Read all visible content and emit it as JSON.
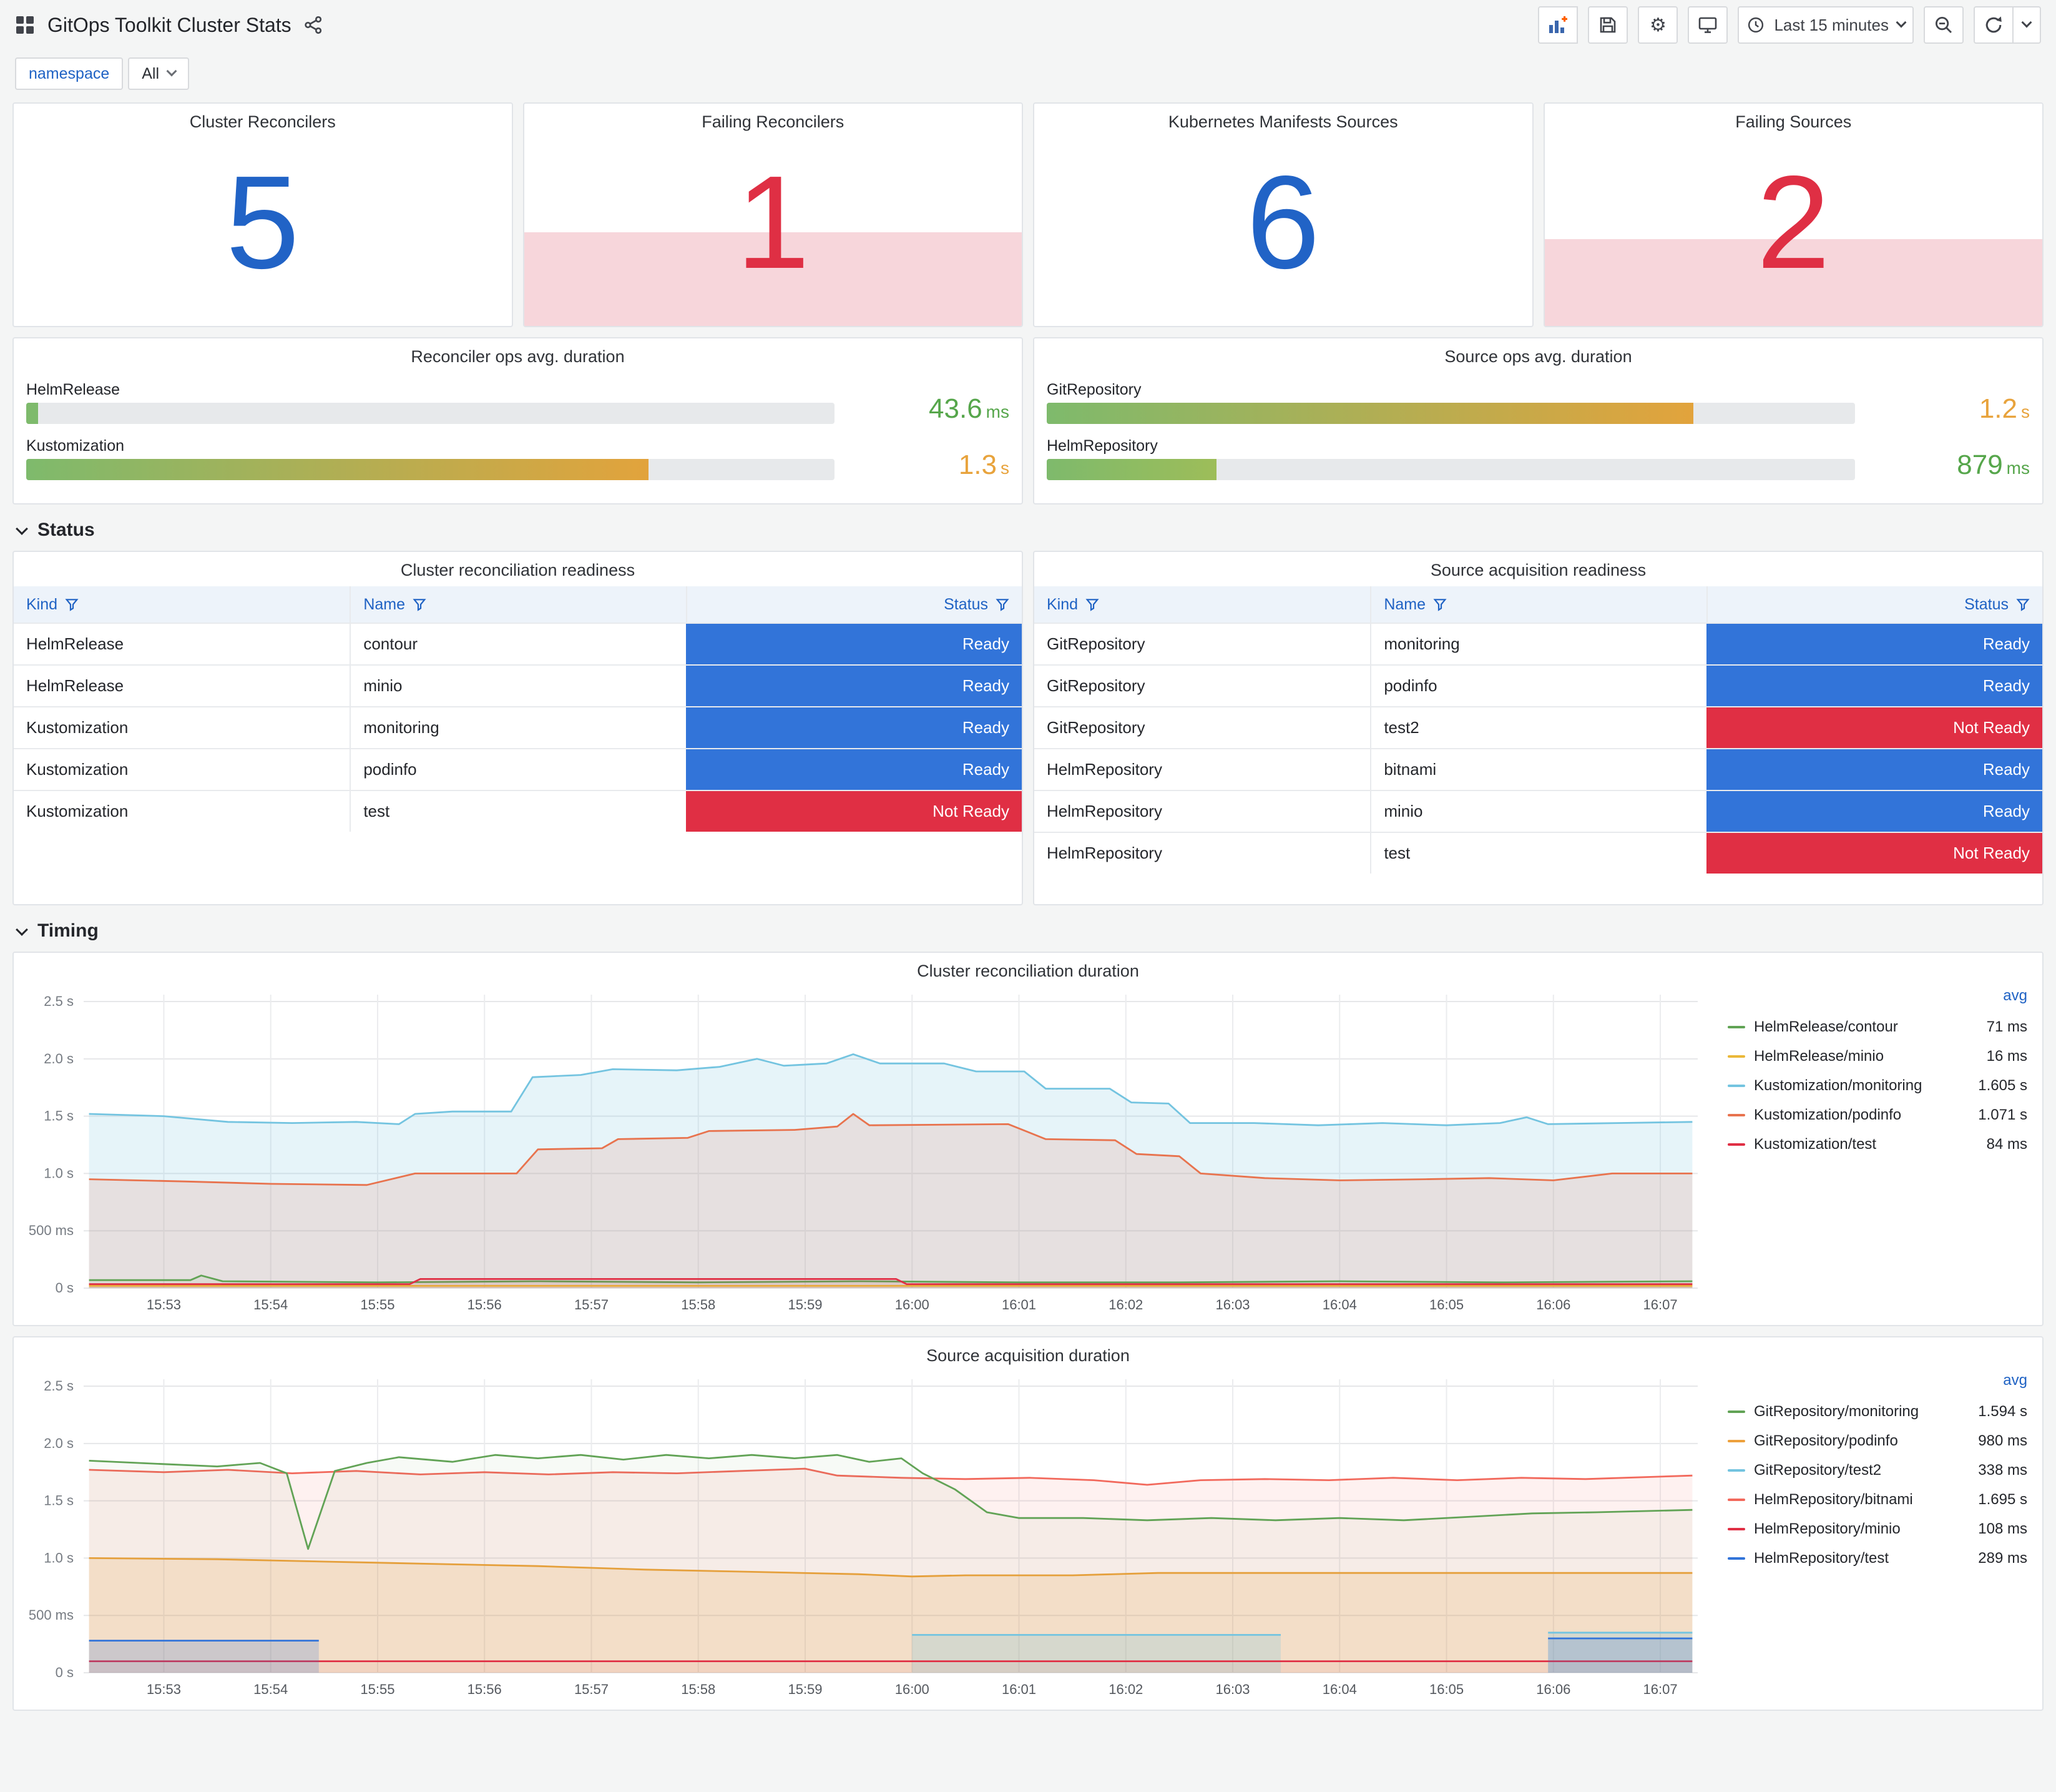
{
  "header": {
    "title": "GitOps Toolkit Cluster Stats",
    "time_picker": {
      "label": "Last 15 minutes"
    },
    "icons": [
      "dashboard-grid",
      "share-alt",
      "add-panel",
      "save",
      "settings-gear",
      "tv-mode",
      "clock",
      "zoom-out",
      "refresh",
      "caret-down"
    ]
  },
  "variables": {
    "label": "namespace",
    "value": "All"
  },
  "colors": {
    "accent_blue": "#2163c6",
    "alert_red": "#df2f44",
    "ready_bg": "#3274d9",
    "not_ready_bg": "#e02f44",
    "threshold_fill": "#f7d6db",
    "link_blue": "#1f62c4",
    "green_text": "#56a64b",
    "orange_text": "#e8a33c"
  },
  "stats": [
    {
      "title": "Cluster Reconcilers",
      "value": "5",
      "color": "#2163c6",
      "fill_pct": 0
    },
    {
      "title": "Failing Reconcilers",
      "value": "1",
      "color": "#df2f44",
      "fill_pct": 42
    },
    {
      "title": "Kubernetes Manifests Sources",
      "value": "6",
      "color": "#2163c6",
      "fill_pct": 0
    },
    {
      "title": "Failing Sources",
      "value": "2",
      "color": "#df2f44",
      "fill_pct": 39
    }
  ],
  "gauges": [
    {
      "title": "Reconciler ops avg. duration",
      "bars": [
        {
          "label": "HelmRelease",
          "value": "43.6",
          "unit": "ms",
          "pct": 1.5,
          "bar_from": "#7eba6c",
          "bar_to": "#7eba6c",
          "value_color": "#56a64b"
        },
        {
          "label": "Kustomization",
          "value": "1.3",
          "unit": "s",
          "pct": 77,
          "bar_from": "#7eba6c",
          "bar_to": "#e2a33c",
          "value_color": "#e8a33c"
        }
      ]
    },
    {
      "title": "Source ops avg. duration",
      "bars": [
        {
          "label": "GitRepository",
          "value": "1.2",
          "unit": "s",
          "pct": 80,
          "bar_from": "#7eba6c",
          "bar_to": "#e2a33c",
          "value_color": "#e8a33c"
        },
        {
          "label": "HelmRepository",
          "value": "879",
          "unit": "ms",
          "pct": 21,
          "bar_from": "#7eba6c",
          "bar_to": "#9dbd59",
          "value_color": "#56a64b"
        }
      ]
    }
  ],
  "sections": {
    "status": "Status",
    "timing": "Timing"
  },
  "tables": [
    {
      "title": "Cluster reconciliation readiness",
      "columns": [
        "Kind",
        "Name",
        "Status"
      ],
      "rows": [
        [
          "HelmRelease",
          "contour",
          "Ready"
        ],
        [
          "HelmRelease",
          "minio",
          "Ready"
        ],
        [
          "Kustomization",
          "monitoring",
          "Ready"
        ],
        [
          "Kustomization",
          "podinfo",
          "Ready"
        ],
        [
          "Kustomization",
          "test",
          "Not Ready"
        ]
      ]
    },
    {
      "title": "Source acquisition readiness",
      "columns": [
        "Kind",
        "Name",
        "Status"
      ],
      "rows": [
        [
          "GitRepository",
          "monitoring",
          "Ready"
        ],
        [
          "GitRepository",
          "podinfo",
          "Ready"
        ],
        [
          "GitRepository",
          "test2",
          "Not Ready"
        ],
        [
          "HelmRepository",
          "bitnami",
          "Ready"
        ],
        [
          "HelmRepository",
          "minio",
          "Ready"
        ],
        [
          "HelmRepository",
          "test",
          "Not Ready"
        ]
      ]
    }
  ],
  "chart_data": [
    {
      "type": "line",
      "title": "Cluster reconciliation duration",
      "legend_header": "avg",
      "xlim": [
        -0.75,
        14.35
      ],
      "ylim": [
        0,
        2.56
      ],
      "x_ticks": [
        "15:53",
        "15:54",
        "15:55",
        "15:56",
        "15:57",
        "15:58",
        "15:59",
        "16:00",
        "16:01",
        "16:02",
        "16:03",
        "16:04",
        "16:05",
        "16:06",
        "16:07"
      ],
      "y_ticks": [
        [
          0,
          "0 s"
        ],
        [
          0.5,
          "500 ms"
        ],
        [
          1,
          "1.0 s"
        ],
        [
          1.5,
          "1.5 s"
        ],
        [
          2,
          "2.0 s"
        ],
        [
          2.5,
          "2.5 s"
        ]
      ],
      "series": [
        {
          "name": "HelmRelease/contour",
          "avg": "71 ms",
          "color": "#61a355",
          "fill": 0.08,
          "z": 2,
          "points": [
            [
              -0.7,
              0.07
            ],
            [
              0.25,
              0.07
            ],
            [
              0.35,
              0.11
            ],
            [
              0.55,
              0.06
            ],
            [
              2,
              0.05
            ],
            [
              3.5,
              0.06
            ],
            [
              5,
              0.05
            ],
            [
              6.5,
              0.06
            ],
            [
              8,
              0.05
            ],
            [
              9.5,
              0.05
            ],
            [
              11,
              0.06
            ],
            [
              12.5,
              0.05
            ],
            [
              14.3,
              0.06
            ]
          ]
        },
        {
          "name": "HelmRelease/minio",
          "avg": "16 ms",
          "color": "#eab839",
          "fill": 0.08,
          "z": 3,
          "points": [
            [
              -0.7,
              0.02
            ],
            [
              14.3,
              0.02
            ]
          ]
        },
        {
          "name": "Kustomization/monitoring",
          "avg": "1.605 s",
          "color": "#74c4e0",
          "fill": 0.18,
          "z": 0,
          "points": [
            [
              -0.7,
              1.52
            ],
            [
              0,
              1.5
            ],
            [
              0.6,
              1.45
            ],
            [
              1.2,
              1.44
            ],
            [
              1.8,
              1.45
            ],
            [
              2.2,
              1.43
            ],
            [
              2.35,
              1.52
            ],
            [
              2.7,
              1.54
            ],
            [
              3.25,
              1.54
            ],
            [
              3.45,
              1.84
            ],
            [
              3.9,
              1.86
            ],
            [
              4.2,
              1.91
            ],
            [
              4.8,
              1.9
            ],
            [
              5.2,
              1.93
            ],
            [
              5.55,
              2.0
            ],
            [
              5.8,
              1.94
            ],
            [
              6.2,
              1.96
            ],
            [
              6.45,
              2.04
            ],
            [
              6.7,
              1.96
            ],
            [
              7.3,
              1.96
            ],
            [
              7.6,
              1.89
            ],
            [
              8.05,
              1.89
            ],
            [
              8.25,
              1.74
            ],
            [
              8.85,
              1.74
            ],
            [
              9.05,
              1.62
            ],
            [
              9.4,
              1.61
            ],
            [
              9.6,
              1.44
            ],
            [
              10.2,
              1.44
            ],
            [
              10.8,
              1.42
            ],
            [
              11.4,
              1.44
            ],
            [
              12,
              1.42
            ],
            [
              12.5,
              1.44
            ],
            [
              12.75,
              1.49
            ],
            [
              12.95,
              1.43
            ],
            [
              13.6,
              1.44
            ],
            [
              14.3,
              1.45
            ]
          ]
        },
        {
          "name": "Kustomization/podinfo",
          "avg": "1.071 s",
          "color": "#e8734e",
          "fill": 0.15,
          "z": 1,
          "points": [
            [
              -0.7,
              0.95
            ],
            [
              0.2,
              0.93
            ],
            [
              1,
              0.91
            ],
            [
              1.9,
              0.9
            ],
            [
              2.35,
              1.0
            ],
            [
              3.3,
              1.0
            ],
            [
              3.5,
              1.21
            ],
            [
              4.1,
              1.22
            ],
            [
              4.25,
              1.3
            ],
            [
              4.9,
              1.31
            ],
            [
              5.1,
              1.37
            ],
            [
              5.9,
              1.38
            ],
            [
              6.3,
              1.41
            ],
            [
              6.45,
              1.52
            ],
            [
              6.6,
              1.42
            ],
            [
              7.9,
              1.43
            ],
            [
              8.25,
              1.3
            ],
            [
              8.9,
              1.29
            ],
            [
              9.1,
              1.17
            ],
            [
              9.5,
              1.15
            ],
            [
              9.7,
              1.0
            ],
            [
              10.3,
              0.96
            ],
            [
              11,
              0.94
            ],
            [
              11.8,
              0.95
            ],
            [
              12.4,
              0.96
            ],
            [
              13,
              0.94
            ],
            [
              13.55,
              1.0
            ],
            [
              14.3,
              1.0
            ]
          ]
        },
        {
          "name": "Kustomization/test",
          "avg": "84 ms",
          "color": "#e02f44",
          "fill": 0.1,
          "z": 4,
          "points": [
            [
              -0.7,
              0.035
            ],
            [
              2.3,
              0.035
            ],
            [
              2.4,
              0.08
            ],
            [
              6.85,
              0.08
            ],
            [
              6.95,
              0.035
            ],
            [
              14.3,
              0.035
            ]
          ]
        }
      ]
    },
    {
      "type": "line",
      "title": "Source acquisition duration",
      "legend_header": "avg",
      "xlim": [
        -0.75,
        14.35
      ],
      "ylim": [
        0,
        2.56
      ],
      "x_ticks": [
        "15:53",
        "15:54",
        "15:55",
        "15:56",
        "15:57",
        "15:58",
        "15:59",
        "16:00",
        "16:01",
        "16:02",
        "16:03",
        "16:04",
        "16:05",
        "16:06",
        "16:07"
      ],
      "y_ticks": [
        [
          0,
          "0 s"
        ],
        [
          0.5,
          "500 ms"
        ],
        [
          1,
          "1.0 s"
        ],
        [
          1.5,
          "1.5 s"
        ],
        [
          2,
          "2.0 s"
        ],
        [
          2.5,
          "2.5 s"
        ]
      ],
      "series": [
        {
          "name": "GitRepository/monitoring",
          "avg": "1.594 s",
          "color": "#62a356",
          "fill": 0.05,
          "z": 2,
          "points": [
            [
              -0.7,
              1.85
            ],
            [
              0,
              1.82
            ],
            [
              0.5,
              1.8
            ],
            [
              0.9,
              1.83
            ],
            [
              1.15,
              1.74
            ],
            [
              1.35,
              1.08
            ],
            [
              1.6,
              1.76
            ],
            [
              1.9,
              1.83
            ],
            [
              2.2,
              1.88
            ],
            [
              2.7,
              1.84
            ],
            [
              3.1,
              1.9
            ],
            [
              3.5,
              1.87
            ],
            [
              3.9,
              1.9
            ],
            [
              4.3,
              1.86
            ],
            [
              4.7,
              1.9
            ],
            [
              5.1,
              1.87
            ],
            [
              5.5,
              1.9
            ],
            [
              5.9,
              1.87
            ],
            [
              6.3,
              1.9
            ],
            [
              6.6,
              1.84
            ],
            [
              6.9,
              1.87
            ],
            [
              7.1,
              1.74
            ],
            [
              7.4,
              1.6
            ],
            [
              7.7,
              1.4
            ],
            [
              8,
              1.35
            ],
            [
              8.6,
              1.35
            ],
            [
              9.2,
              1.33
            ],
            [
              9.8,
              1.35
            ],
            [
              10.4,
              1.33
            ],
            [
              11,
              1.35
            ],
            [
              11.6,
              1.33
            ],
            [
              12.2,
              1.36
            ],
            [
              12.8,
              1.39
            ],
            [
              13.4,
              1.4
            ],
            [
              14.3,
              1.42
            ]
          ]
        },
        {
          "name": "GitRepository/podinfo",
          "avg": "980 ms",
          "color": "#eda13c",
          "fill": 0.18,
          "z": 1,
          "points": [
            [
              -0.7,
              1.0
            ],
            [
              0.5,
              0.99
            ],
            [
              1.5,
              0.97
            ],
            [
              2.5,
              0.95
            ],
            [
              3.5,
              0.93
            ],
            [
              4.5,
              0.9
            ],
            [
              5.5,
              0.88
            ],
            [
              6.5,
              0.86
            ],
            [
              7,
              0.84
            ],
            [
              7.5,
              0.85
            ],
            [
              8.5,
              0.85
            ],
            [
              9.3,
              0.87
            ],
            [
              10.5,
              0.87
            ],
            [
              11.5,
              0.87
            ],
            [
              12.5,
              0.87
            ],
            [
              13.5,
              0.87
            ],
            [
              14.3,
              0.87
            ]
          ]
        },
        {
          "name": "GitRepository/test2",
          "avg": "338 ms",
          "color": "#74c4e0",
          "fill": 0.22,
          "z": 3,
          "points": [
            [
              7,
              0.33
            ],
            [
              8.2,
              0.33
            ],
            [
              9.4,
              0.33
            ],
            [
              10.45,
              0.33
            ],
            [
              10.5,
              null
            ],
            [
              12.95,
              0.35
            ],
            [
              14.3,
              0.35
            ]
          ]
        },
        {
          "name": "HelmRepository/bitnami",
          "avg": "1.695 s",
          "color": "#f2695c",
          "fill": 0.09,
          "z": 0,
          "points": [
            [
              -0.7,
              1.77
            ],
            [
              0,
              1.75
            ],
            [
              0.6,
              1.77
            ],
            [
              1.2,
              1.74
            ],
            [
              1.8,
              1.76
            ],
            [
              2.4,
              1.73
            ],
            [
              3,
              1.75
            ],
            [
              3.6,
              1.73
            ],
            [
              4.2,
              1.75
            ],
            [
              4.8,
              1.74
            ],
            [
              5.4,
              1.76
            ],
            [
              6,
              1.78
            ],
            [
              6.3,
              1.72
            ],
            [
              6.9,
              1.7
            ],
            [
              7.5,
              1.69
            ],
            [
              8.1,
              1.7
            ],
            [
              8.7,
              1.68
            ],
            [
              9.2,
              1.64
            ],
            [
              9.7,
              1.68
            ],
            [
              10.3,
              1.69
            ],
            [
              10.9,
              1.68
            ],
            [
              11.5,
              1.7
            ],
            [
              12.1,
              1.68
            ],
            [
              12.7,
              1.7
            ],
            [
              13.3,
              1.69
            ],
            [
              14.3,
              1.72
            ]
          ]
        },
        {
          "name": "HelmRepository/minio",
          "avg": "108 ms",
          "color": "#e02f44",
          "fill": 0.06,
          "z": 4,
          "points": [
            [
              -0.7,
              0.1
            ],
            [
              14.3,
              0.1
            ]
          ]
        },
        {
          "name": "HelmRepository/test",
          "avg": "289 ms",
          "color": "#3274d9",
          "fill": 0.2,
          "z": 5,
          "points": [
            [
              -0.7,
              0.28
            ],
            [
              1.45,
              0.28
            ],
            [
              1.5,
              null
            ],
            [
              12.95,
              0.3
            ],
            [
              14.3,
              0.3
            ]
          ]
        }
      ]
    }
  ]
}
